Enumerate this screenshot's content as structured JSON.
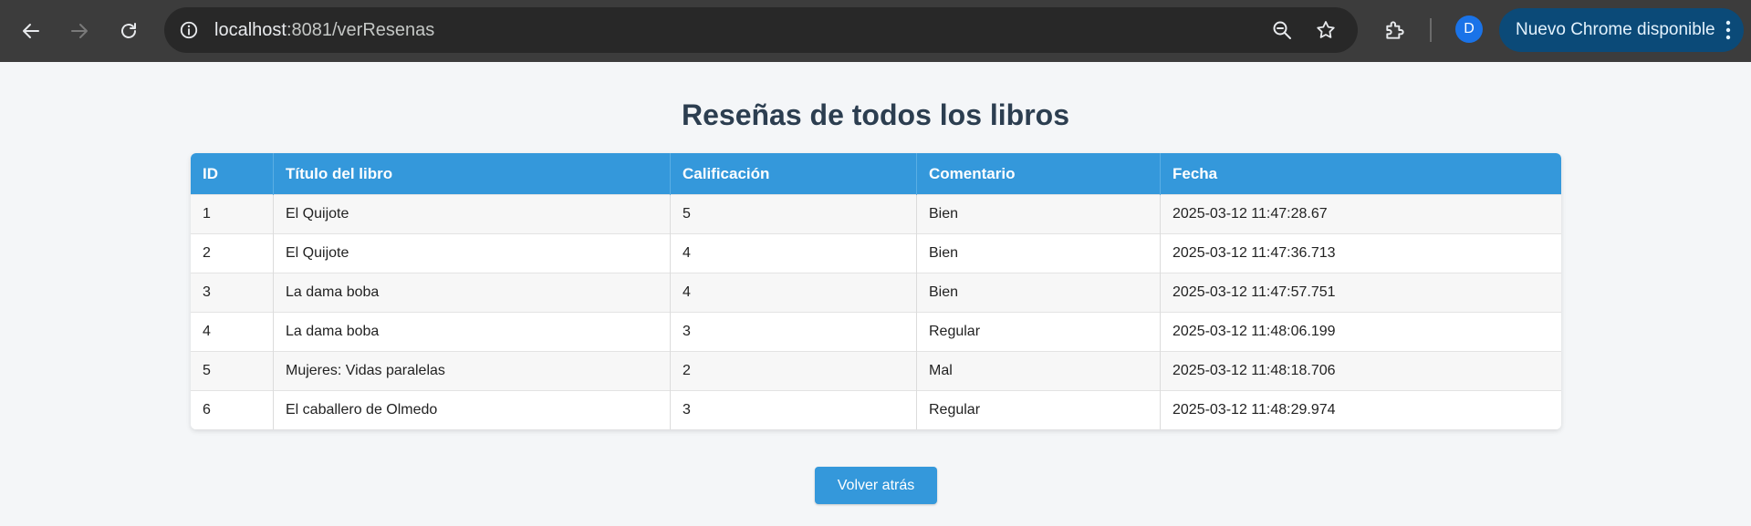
{
  "browser": {
    "url_host": "localhost",
    "url_port": ":8081",
    "url_path": "/verResenas",
    "profile_initial": "D",
    "update_label": "Nuevo Chrome disponible",
    "icons": {
      "back": "arrow-left-icon",
      "forward": "arrow-right-icon",
      "reload": "reload-icon",
      "site_info": "info-icon",
      "zoom": "zoom-icon",
      "bookmark": "star-icon",
      "extensions": "puzzle-icon",
      "menu": "kebab-icon"
    },
    "colors": {
      "toolbar": "#3c3c3c",
      "omnibox": "#282828",
      "avatar": "#1a73e8",
      "update_button": "#0b4a78"
    }
  },
  "page": {
    "title": "Reseñas de todos los libros",
    "table": {
      "headers": [
        "ID",
        "Título del libro",
        "Calificación",
        "Comentario",
        "Fecha"
      ],
      "rows": [
        [
          "1",
          "El Quijote",
          "5",
          "Bien",
          "2025-03-12 11:47:28.67"
        ],
        [
          "2",
          "El Quijote",
          "4",
          "Bien",
          "2025-03-12 11:47:36.713"
        ],
        [
          "3",
          "La dama boba",
          "4",
          "Bien",
          "2025-03-12 11:47:57.751"
        ],
        [
          "4",
          "La dama boba",
          "3",
          "Regular",
          "2025-03-12 11:48:06.199"
        ],
        [
          "5",
          "Mujeres: Vidas paralelas",
          "2",
          "Mal",
          "2025-03-12 11:48:18.706"
        ],
        [
          "6",
          "El caballero de Olmedo",
          "3",
          "Regular",
          "2025-03-12 11:48:29.974"
        ]
      ]
    },
    "back_button_label": "Volver atrás",
    "colors": {
      "accent": "#3498db",
      "title": "#2c3e50",
      "background": "#f4f6f8"
    }
  }
}
